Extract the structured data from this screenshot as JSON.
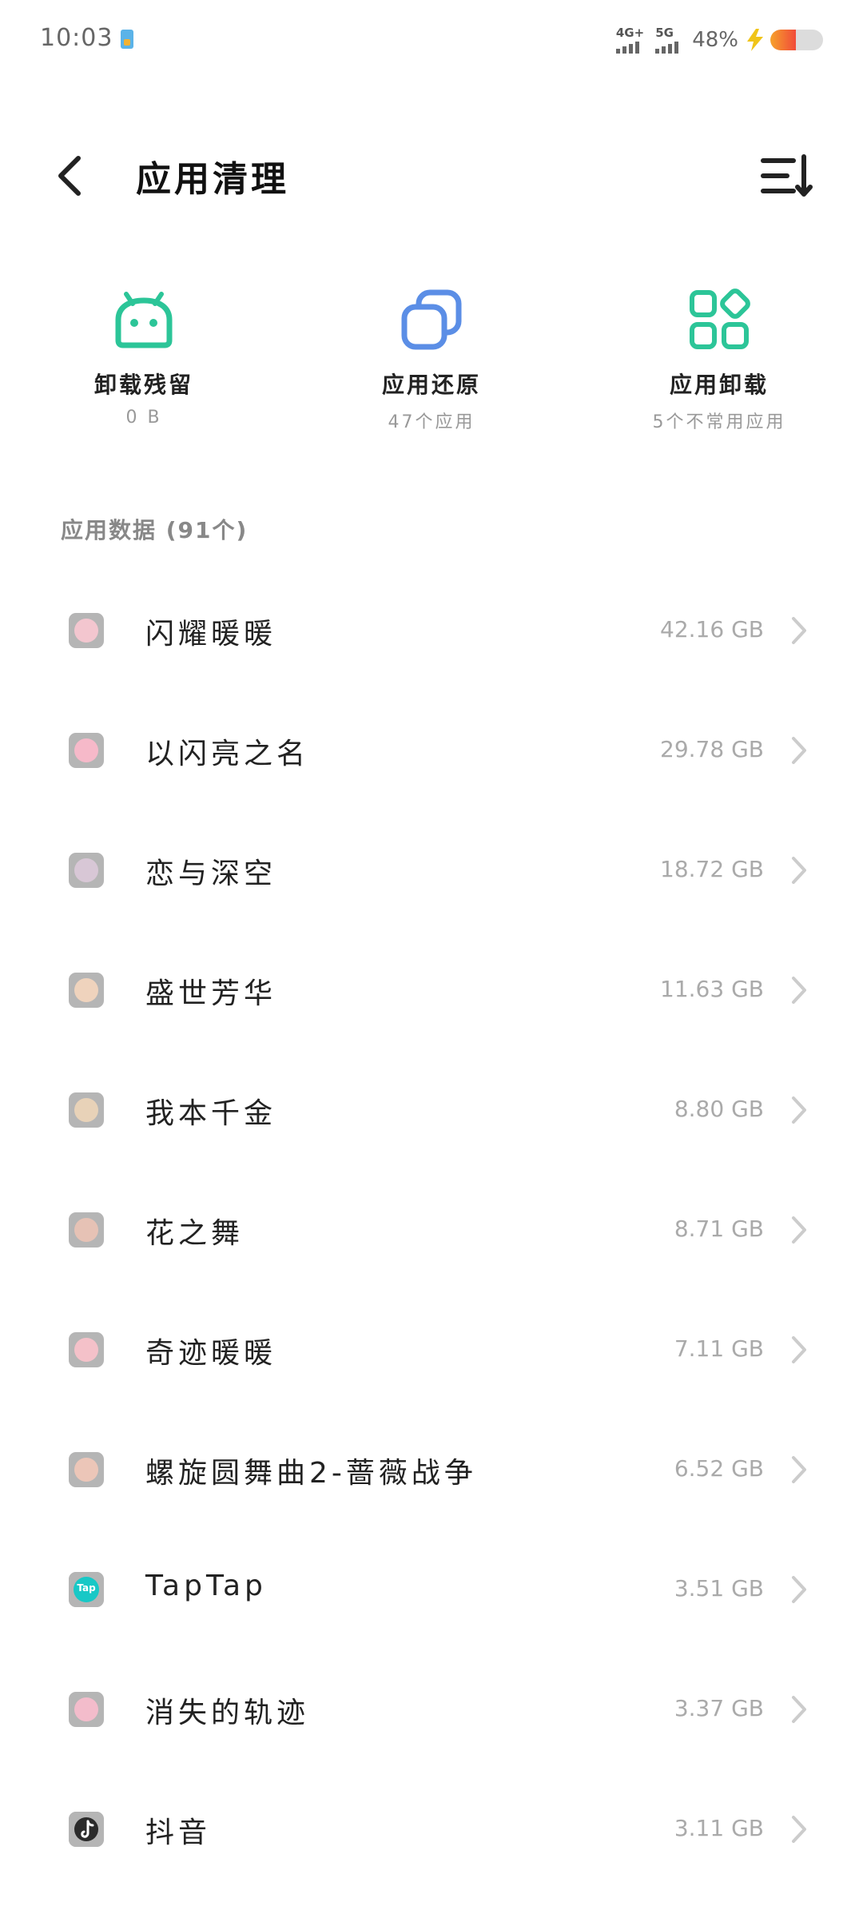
{
  "status_bar": {
    "time": "10:03",
    "network_1": "4G+",
    "network_2": "5G",
    "battery_percent": "48%",
    "battery_level": 0.48
  },
  "header": {
    "title": "应用清理"
  },
  "quick_actions": [
    {
      "label": "卸载残留",
      "sub": "0 B",
      "icon": "android-icon",
      "color": "#2cc598"
    },
    {
      "label": "应用还原",
      "sub": "47个应用",
      "icon": "restore-copy-icon",
      "color": "#5b8ee6"
    },
    {
      "label": "应用卸载",
      "sub": "5个不常用应用",
      "icon": "apps-grid-icon",
      "color": "#2cc598"
    }
  ],
  "section": {
    "title": "应用数据 (91个)"
  },
  "apps": [
    {
      "name": "闪耀暖暖",
      "size": "42.16 GB",
      "icon": "app-avatar-icon"
    },
    {
      "name": "以闪亮之名",
      "size": "29.78 GB",
      "icon": "app-avatar-icon"
    },
    {
      "name": "恋与深空",
      "size": "18.72 GB",
      "icon": "app-avatar-icon"
    },
    {
      "name": "盛世芳华",
      "size": "11.63 GB",
      "icon": "app-avatar-icon"
    },
    {
      "name": "我本千金",
      "size": "8.80 GB",
      "icon": "app-avatar-icon"
    },
    {
      "name": "花之舞",
      "size": "8.71 GB",
      "icon": "app-avatar-icon"
    },
    {
      "name": "奇迹暖暖",
      "size": "7.11 GB",
      "icon": "app-avatar-icon"
    },
    {
      "name": "螺旋圆舞曲2-蔷薇战争",
      "size": "6.52 GB",
      "icon": "app-avatar-icon"
    },
    {
      "name": "TapTap",
      "size": "3.51 GB",
      "icon": "taptap-icon",
      "badge": "Tap"
    },
    {
      "name": "消失的轨迹",
      "size": "3.37 GB",
      "icon": "app-avatar-icon"
    },
    {
      "name": "抖音",
      "size": "3.11 GB",
      "icon": "tiktok-icon"
    }
  ],
  "colors": {
    "accent_green": "#2cc598",
    "accent_blue": "#5b8ee6",
    "taptap": "#18c8c6"
  }
}
